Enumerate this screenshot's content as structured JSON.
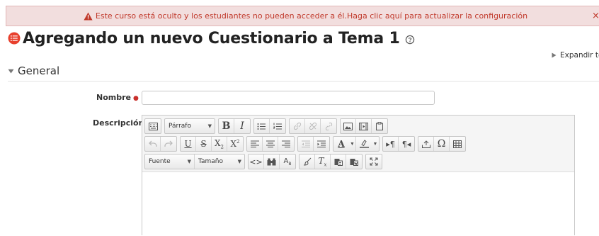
{
  "alert": {
    "message": "Este curso está oculto y los estudiantes no pueden acceder a él.Haga clic aquí para actualizar la configuración",
    "close": "×",
    "warning_color": "#c0392b"
  },
  "header": {
    "title": "Agregando un nuevo Cuestionario a Tema 1",
    "title_icon": "quiz-icon",
    "help_icon": "help-icon"
  },
  "expand_all": "Expandir tod",
  "section": {
    "title": "General"
  },
  "form": {
    "name_label": "Nombre",
    "required_mark": "●",
    "name_value": "",
    "description_label": "Descripción"
  },
  "editor": {
    "paragraph_combo": "Párrafo",
    "font_combo": "Fuente",
    "size_combo": "Tamaño"
  }
}
